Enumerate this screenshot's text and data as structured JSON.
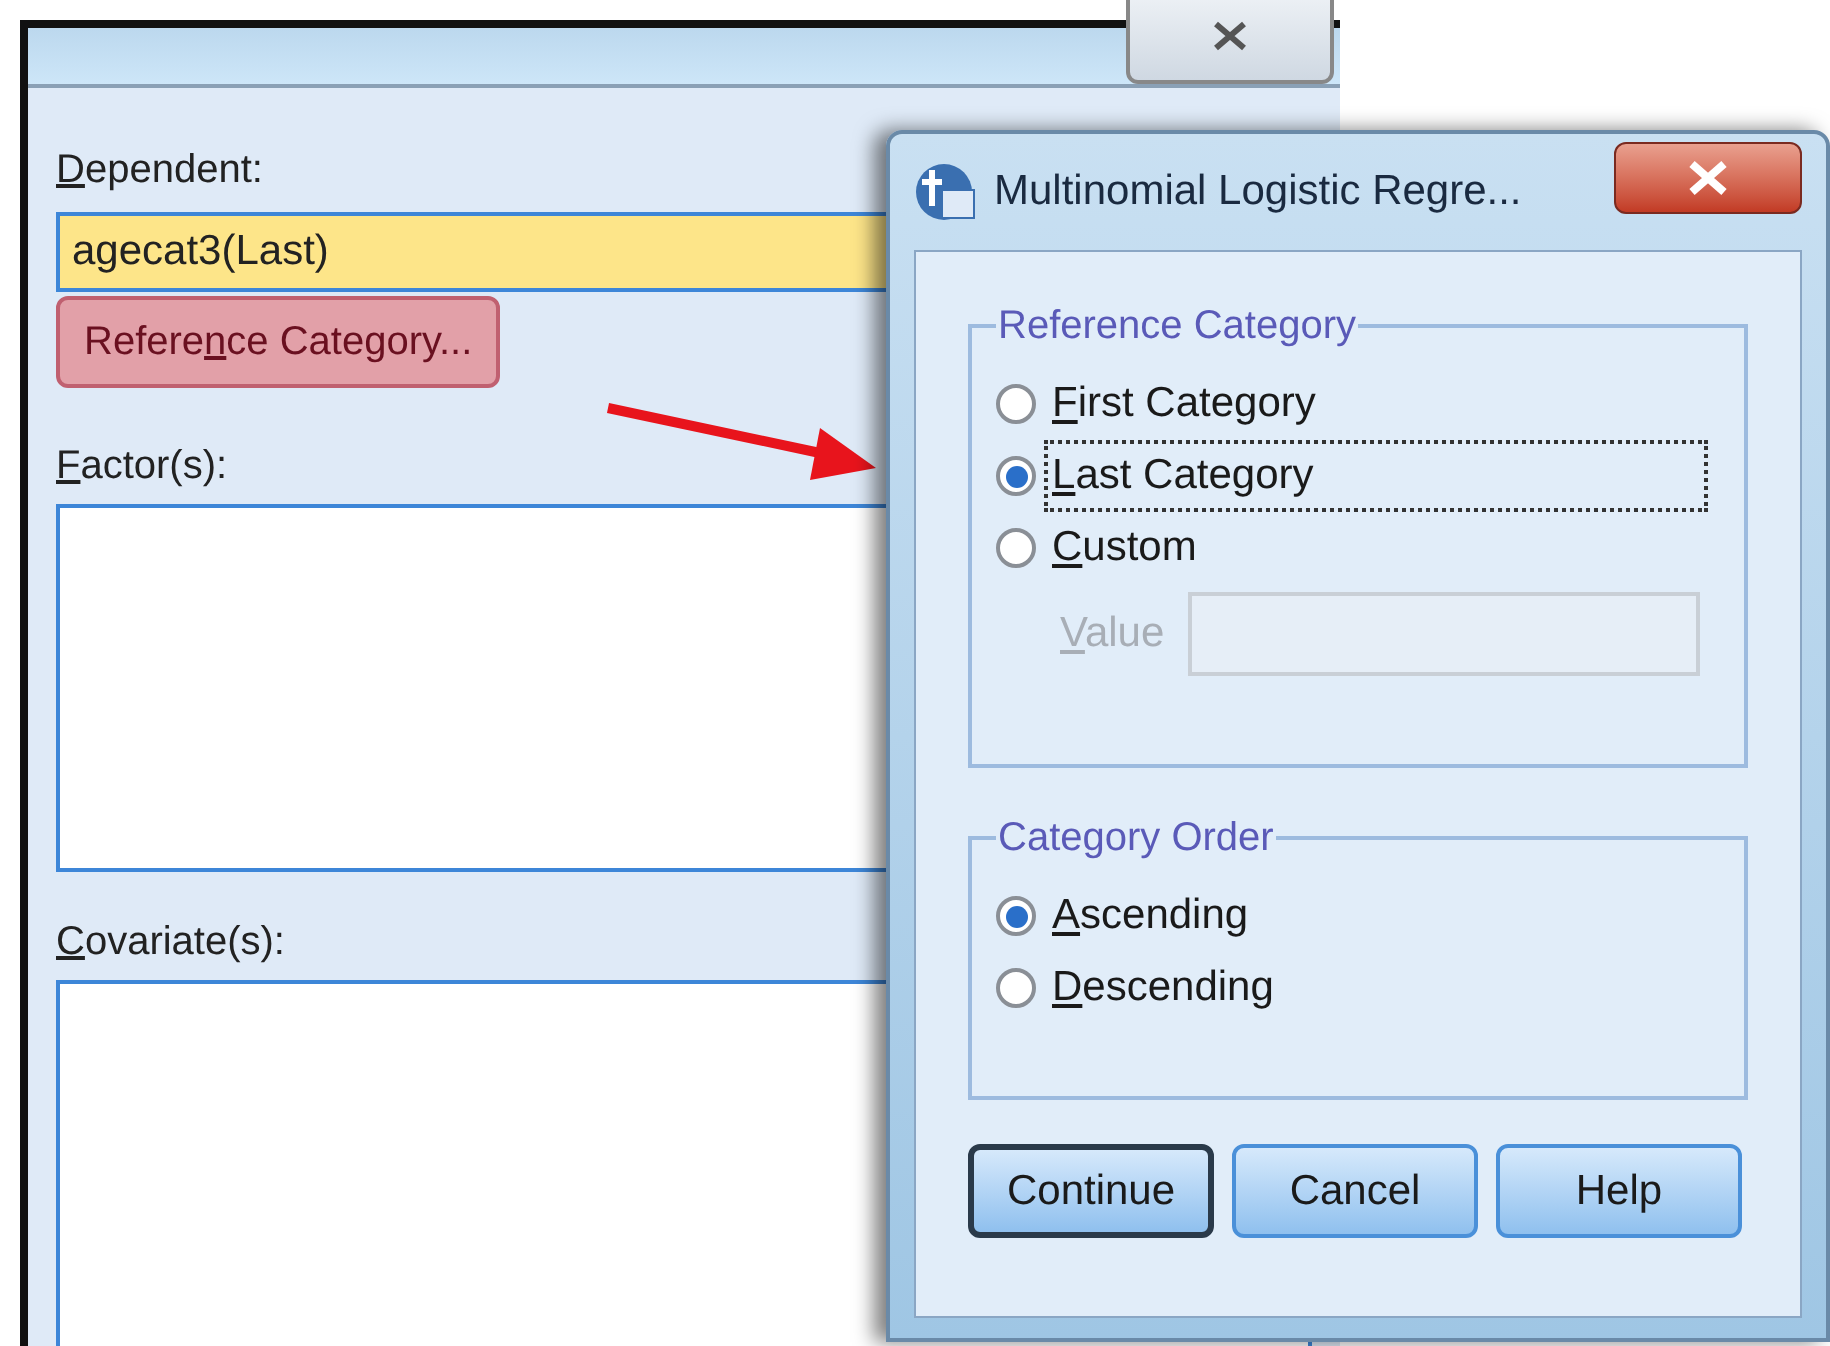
{
  "main_window": {
    "dependent_label": {
      "key": "D",
      "rest": "ependent:"
    },
    "dependent_value": "agecat3(Last)",
    "reference_button": {
      "before": "Refere",
      "key": "n",
      "rest": "ce Category..."
    },
    "factors_label": {
      "key": "F",
      "rest": "actor(s):"
    },
    "covariates_label": {
      "key": "C",
      "rest": "ovariate(s):"
    }
  },
  "dialog": {
    "title": "Multinomial Logistic Regre...",
    "groups": [
      {
        "title": "Reference Category",
        "options": [
          {
            "label": {
              "key": "F",
              "rest": "irst Category"
            },
            "selected": false,
            "focused": false
          },
          {
            "label": {
              "key": "L",
              "rest": "ast Category"
            },
            "selected": true,
            "focused": true
          },
          {
            "label": {
              "key": "C",
              "rest": "ustom"
            },
            "selected": false,
            "focused": false
          }
        ],
        "value_field": {
          "label": {
            "key": "V",
            "rest": "alue"
          },
          "disabled": true
        }
      },
      {
        "title": "Category Order",
        "options": [
          {
            "label": {
              "key": "A",
              "rest": "scending"
            },
            "selected": true,
            "focused": false
          },
          {
            "label": {
              "key": "D",
              "rest": "escending"
            },
            "selected": false,
            "focused": false
          }
        ]
      }
    ],
    "buttons": [
      {
        "label": "Continue",
        "default": true
      },
      {
        "label": "Cancel",
        "default": false
      },
      {
        "label": "Help",
        "default": false
      }
    ]
  }
}
